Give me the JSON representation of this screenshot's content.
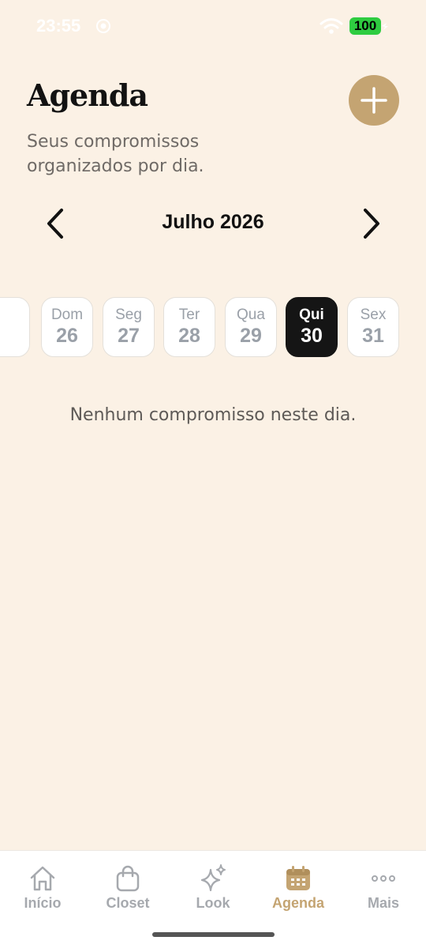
{
  "status_bar": {
    "time": "23:55",
    "battery": "100"
  },
  "header": {
    "title": "Agenda",
    "subtitle": "Seus compromissos organizados por dia."
  },
  "month_nav": {
    "label": "Julho 2026"
  },
  "days": [
    {
      "dow": "Dom",
      "num": "26",
      "selected": false
    },
    {
      "dow": "Seg",
      "num": "27",
      "selected": false
    },
    {
      "dow": "Ter",
      "num": "28",
      "selected": false
    },
    {
      "dow": "Qua",
      "num": "29",
      "selected": false
    },
    {
      "dow": "Qui",
      "num": "30",
      "selected": true
    },
    {
      "dow": "Sex",
      "num": "31",
      "selected": false
    }
  ],
  "empty_message": "Nenhum compromisso neste dia.",
  "tabs": [
    {
      "label": "Início",
      "icon": "home-icon",
      "active": false
    },
    {
      "label": "Closet",
      "icon": "shopping-bag-icon",
      "active": false
    },
    {
      "label": "Look",
      "icon": "sparkles-icon",
      "active": false
    },
    {
      "label": "Agenda",
      "icon": "calendar-icon",
      "active": true
    },
    {
      "label": "Mais",
      "icon": "more-dots-icon",
      "active": false
    }
  ],
  "colors": {
    "background": "#FBF1E5",
    "accent": "#C4A472",
    "selected_chip": "#151515",
    "inactive_tab": "#A6A9AE"
  }
}
